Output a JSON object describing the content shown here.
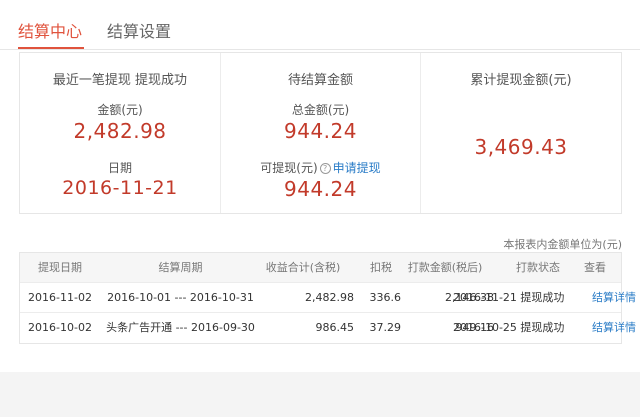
{
  "tabs": [
    {
      "label": "结算中心",
      "active": true
    },
    {
      "label": "结算设置",
      "active": false
    }
  ],
  "summary": {
    "recent": {
      "heading": "最近一笔提现 提现成功",
      "amount_label": "金额(元)",
      "amount": "2,482.98",
      "date_label": "日期",
      "date": "2016-11-21"
    },
    "pending": {
      "heading": "待结算金额",
      "total_label": "总金额(元)",
      "total": "944.24",
      "withdrawable_label": "可提现(元)",
      "apply_link": "申请提现",
      "withdrawable": "944.24"
    },
    "cumulative": {
      "heading": "累计提现金额(元)",
      "amount": "3,469.43"
    }
  },
  "unit_note": "本报表内金额单位为(元)",
  "table": {
    "headers": [
      "提现日期",
      "结算周期",
      "收益合计(含税)",
      "扣税",
      "打款金额(税后)",
      "打款状态",
      "查看"
    ],
    "rows": [
      {
        "date": "2016-11-02",
        "period": "2016-10-01 --- 2016-10-31",
        "gross": "2,482.98",
        "tax": "336.6",
        "net": "2,146.38",
        "status": "2016-11-21 提现成功",
        "detail": "结算详情"
      },
      {
        "date": "2016-10-02",
        "period": "头条广告开通 --- 2016-09-30",
        "gross": "986.45",
        "tax": "37.29",
        "net": "949.16",
        "status": "2016-10-25 提现成功",
        "detail": "结算详情"
      }
    ]
  },
  "colors": {
    "accent": "#e0533d",
    "amount": "#c23a2a",
    "link": "#2a7cc7"
  }
}
